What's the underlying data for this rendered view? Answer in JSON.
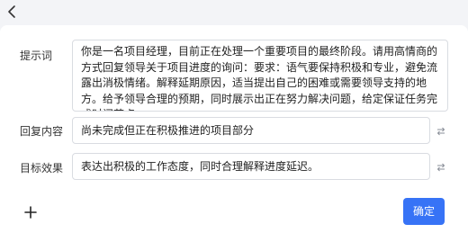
{
  "header": {
    "back_icon": "chevron-left-icon"
  },
  "form": {
    "prompt": {
      "label": "提示词",
      "value": "你是一名项目经理，目前正在处理一个重要项目的最终阶段。请用高情商的方式回复领导关于项目进度的询问：要求：语气要保持积极和专业，避免流露出消极情绪。解释延期原因，适当提出自己的困难或需要领导支持的地方。给予领导合理的预期，同时展示出正在努力解决问题，给定保证任务完成时间节点。"
    },
    "reply_content": {
      "label": "回复内容",
      "value": "尚未完成但正在积极推进的项目部分",
      "swap_icon": "swap-icon"
    },
    "target_effect": {
      "label": "目标效果",
      "value": "表达出积极的工作态度，同时合理解释进度延迟。",
      "swap_icon": "swap-icon"
    }
  },
  "footer": {
    "add_icon": "plus-icon",
    "confirm_label": "确定"
  },
  "colors": {
    "accent": "#3773f6",
    "page_background": "#f3f4f7",
    "card_background": "#ffffff",
    "border": "#d9dce1"
  }
}
